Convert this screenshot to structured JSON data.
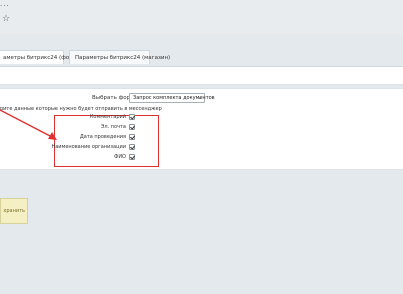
{
  "topbar": {
    "dots": "...",
    "star": "☆"
  },
  "tabs": [
    {
      "label": "аметры битрикс24 (формы)"
    },
    {
      "label": "Параметры битрикс24 (магазин)"
    }
  ],
  "form": {
    "select_label": "Выбрать форму",
    "selected_form": "Запрос комплекта документов",
    "question": "рите данные которые нужно будет отправить в мессенджер",
    "fields": [
      {
        "label": "Комментарий",
        "checked": true
      },
      {
        "label": "Эл. почта",
        "checked": true
      },
      {
        "label": "Дата проведения",
        "checked": true
      },
      {
        "label": "Наименование организации",
        "checked": true
      },
      {
        "label": "ФИО",
        "checked": true
      }
    ]
  },
  "note": {
    "text": "хранить"
  },
  "colors": {
    "highlight_border": "#e03030",
    "arrow": "#e03030",
    "note_bg": "#f5f0c3"
  }
}
